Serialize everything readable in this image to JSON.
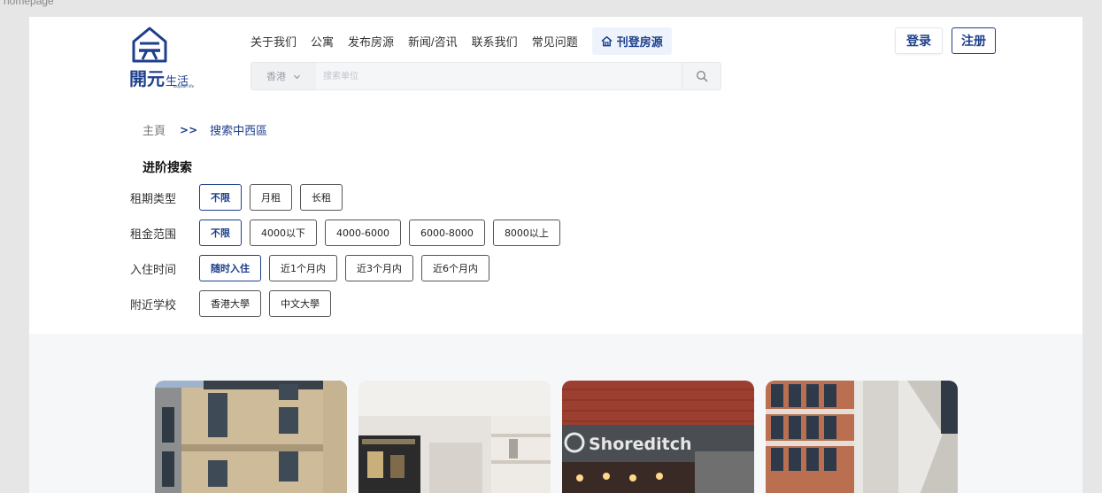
{
  "frame_label": "homepage",
  "brand": {
    "name": "開元",
    "tagline": "生活",
    "english": "kaiyuan life",
    "color": "#1d3f8c"
  },
  "nav": {
    "items": [
      "关于我们",
      "公寓",
      "发布房源",
      "新闻/咨讯",
      "联系我们",
      "常见问题"
    ],
    "cta_label": "刊登房源",
    "cta_icon": "house-icon"
  },
  "auth": {
    "login_label": "登录",
    "register_label": "注册"
  },
  "search": {
    "region": "香港",
    "placeholder": "搜索单位",
    "icon": "search-icon"
  },
  "breadcrumb": {
    "home": "主頁",
    "separator": ">>",
    "current": "搜索中西區"
  },
  "advanced": {
    "title": "进阶搜索",
    "filters": [
      {
        "label": "租期类型",
        "options": [
          "不限",
          "月租",
          "长租"
        ],
        "active": 0
      },
      {
        "label": "租金范围",
        "options": [
          "不限",
          "4000以下",
          "4000-6000",
          "6000-8000",
          "8000以上"
        ],
        "active": 0
      },
      {
        "label": "入住时间",
        "options": [
          "随时入住",
          "近1个月内",
          "近3个月内",
          "近6个月内"
        ],
        "active": 0
      },
      {
        "label": "附近学校",
        "options": [
          "香港大學",
          "中文大學"
        ],
        "active": -1
      }
    ]
  },
  "listings": [
    {
      "image": "brick-apartment-building"
    },
    {
      "image": "interior-kitchen-shelves"
    },
    {
      "image": "shoreditch-brick-sign",
      "sign_text": "Shoreditch"
    },
    {
      "image": "modern-facade-windows"
    }
  ]
}
